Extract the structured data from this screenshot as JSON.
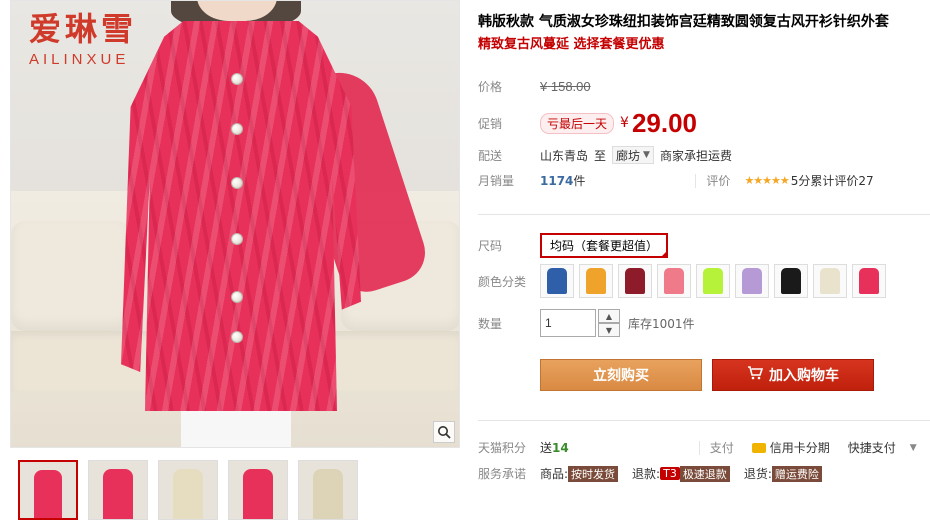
{
  "gallery": {
    "logo_cn": "爱琳雪",
    "logo_en": "AILINXUE",
    "thumbnails": [
      {
        "color": "#e8315a"
      },
      {
        "color": "#e8315a"
      },
      {
        "color": "#e6dcc0"
      },
      {
        "color": "#e8315a"
      },
      {
        "color": "#ddd3b6"
      }
    ]
  },
  "product": {
    "title": "韩版秋款 气质淑女珍珠纽扣装饰宫廷精致圆领复古风开衫针织外套",
    "subtitle": "精致复古风蔓延 选择套餐更优惠"
  },
  "price": {
    "label": "价格",
    "currency": "¥",
    "original": "158.00",
    "promo_label": "促销",
    "promo_tag": "亏最后一天",
    "promo_price": "29.00"
  },
  "shipping": {
    "label": "配送",
    "from": "山东青岛",
    "to_word": "至",
    "destination": "廊坊",
    "fee_text": "商家承担运费"
  },
  "sales": {
    "label": "月销量",
    "count": "1174",
    "unit": "件",
    "rating_label": "评价",
    "stars": "★★★★★",
    "score_text": "5分累计评价27"
  },
  "options": {
    "size_label": "尺码",
    "size_value": "均码（套餐更超值）",
    "color_label": "颜色分类",
    "colors": [
      {
        "color": "#2f5fa8"
      },
      {
        "color": "#f0a32a"
      },
      {
        "color": "#8e1b2a"
      },
      {
        "color": "#ef7a8a"
      },
      {
        "color": "#b6f23a"
      },
      {
        "color": "#b59ad6"
      },
      {
        "color": "#1a1a1a"
      },
      {
        "color": "#e9e2cc"
      },
      {
        "color": "#e8315a"
      }
    ],
    "qty_label": "数量",
    "qty_value": "1",
    "stock_text": "库存1001件"
  },
  "actions": {
    "buy_now": "立刻购买",
    "add_cart": "加入购物车"
  },
  "extras": {
    "points_label": "天猫积分",
    "points_prefix": "送",
    "points_value": "14",
    "pay_label": "支付",
    "pay_card": "信用卡分期",
    "pay_fast": "快捷支付",
    "service_label": "服务承诺",
    "svc_goods_label": "商品:",
    "svc_goods_value": "按时发货",
    "svc_return_label": "退款:",
    "svc_return_badge": "T3",
    "svc_return_value": "极速退款",
    "svc_ship_label": "退货:",
    "svc_ship_value": "赠运费险"
  }
}
